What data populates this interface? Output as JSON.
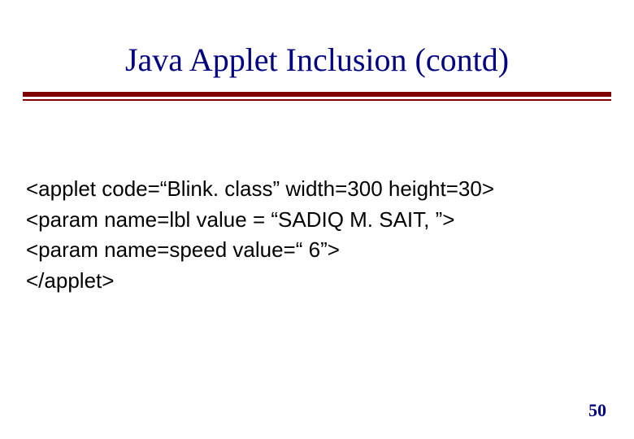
{
  "slide": {
    "title": "Java Applet Inclusion (contd)",
    "lines": {
      "l1": "<applet code=“Blink. class” width=300 height=30>",
      "l2": "<param name=lbl value = “SADIQ M. SAIT, ”>",
      "l3": "<param name=speed value=“ 6”>",
      "l4": "</applet>"
    },
    "page_number": "50"
  }
}
